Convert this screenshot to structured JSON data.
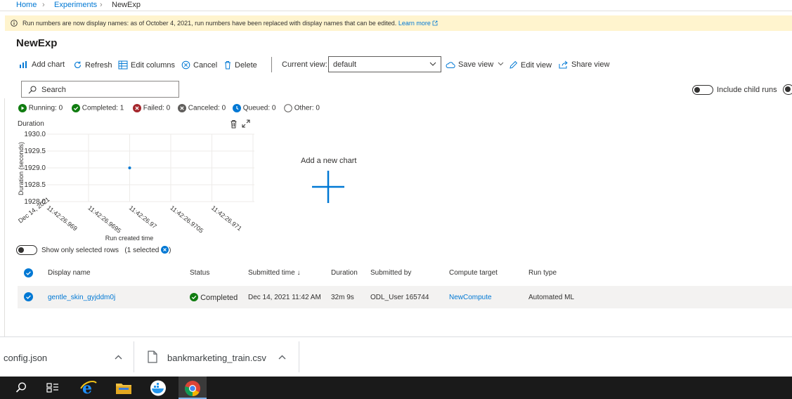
{
  "breadcrumb": {
    "home": "Home",
    "experiments": "Experiments",
    "current": "NewExp"
  },
  "banner": {
    "text": "Run numbers are now display names: as of October 4, 2021, run numbers have been replaced with display names that can be edited.",
    "link": "Learn more"
  },
  "page": {
    "title": "NewExp"
  },
  "toolbar": {
    "add_chart": "Add chart",
    "refresh": "Refresh",
    "edit_columns": "Edit columns",
    "cancel": "Cancel",
    "delete": "Delete",
    "current_view_label": "Current view:",
    "current_view_value": "default",
    "save_view": "Save view",
    "edit_view": "Edit view",
    "share_view": "Share view"
  },
  "search": {
    "placeholder": "Search"
  },
  "include_child_runs": "Include child runs",
  "status_counts": {
    "running": "Running: 0",
    "completed": "Completed: 1",
    "failed": "Failed: 0",
    "canceled": "Canceled: 0",
    "queued": "Queued: 0",
    "other": "Other: 0"
  },
  "chart_data": {
    "type": "scatter",
    "title": "Duration",
    "xlabel": "Run created time",
    "ylabel": "Duration (seconds)",
    "ylim": [
      1928.0,
      1930.0
    ],
    "yticks": [
      "1930.0",
      "1929.5",
      "1929.0",
      "1928.5",
      "1928.0"
    ],
    "xticks": [
      "11:42:26.969",
      "11:42:26.9695",
      "11:42:26.97",
      "11:42:26.9705",
      "11:42:26.971"
    ],
    "x_date_label": "Dec 14, 2021",
    "points": [
      {
        "x": "11:42:26.9695",
        "y": 1929.0
      }
    ],
    "grid": true
  },
  "add_new_chart": "Add a new chart",
  "show_only_selected": {
    "label": "Show only selected rows",
    "count": "(1 selected",
    "close": ")"
  },
  "table": {
    "columns": [
      "Display name",
      "Status",
      "Submitted time ↓",
      "Duration",
      "Submitted by",
      "Compute target",
      "Run type"
    ],
    "rows": [
      {
        "display_name": "gentle_skin_gyjddm0j",
        "status": "Completed",
        "submitted_time": "Dec 14, 2021 11:42 AM",
        "duration": "32m 9s",
        "submitted_by": "ODL_User 165744",
        "compute_target": "NewCompute",
        "run_type": "Automated ML"
      }
    ]
  },
  "downloads": [
    {
      "name": "config.json"
    },
    {
      "name": "bankmarketing_train.csv"
    }
  ],
  "colors": {
    "accent": "#0078d4",
    "success": "#107c10",
    "error": "#a4262c",
    "banner": "#fff4ce"
  }
}
